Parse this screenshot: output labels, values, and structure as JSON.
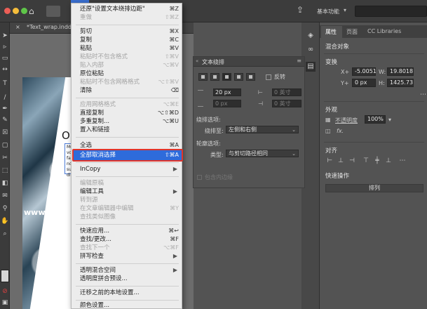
{
  "topbar": {
    "workspace": "基本功能",
    "workspace_chevron": "▾"
  },
  "document": {
    "tab_label": "*Text_wrap.indd @"
  },
  "canvas": {
    "heading_text": "O C",
    "body_lines": [
      "Mus vo",
      "volupt",
      "faces",
      "nonse",
      "sunt",
      "dia"
    ],
    "watermark": "www.MacZ"
  },
  "menu": {
    "items": [
      {
        "label": "还原\"设置文本绕排边距\"",
        "shortcut": "⌘Z",
        "disabled": false
      },
      {
        "label": "重做",
        "shortcut": "⇧⌘Z",
        "disabled": true
      },
      {
        "label": "剪切",
        "shortcut": "⌘X",
        "disabled": false
      },
      {
        "label": "复制",
        "shortcut": "⌘C",
        "disabled": false
      },
      {
        "label": "粘贴",
        "shortcut": "⌘V",
        "disabled": false
      },
      {
        "label": "粘贴时不包含格式",
        "shortcut": "⇧⌘V",
        "disabled": true
      },
      {
        "label": "贴入内部",
        "shortcut": "⌥⌘V",
        "disabled": true
      },
      {
        "label": "原位粘贴",
        "shortcut": "",
        "disabled": false
      },
      {
        "label": "粘贴时不包含网格格式",
        "shortcut": "⌥⇧⌘V",
        "disabled": true
      },
      {
        "label": "清除",
        "shortcut": "⌫",
        "disabled": false
      },
      {
        "label": "应用网格格式",
        "shortcut": "⌥⌘E",
        "disabled": true
      },
      {
        "label": "直接复制",
        "shortcut": "⌥⇧⌘D",
        "disabled": false
      },
      {
        "label": "多重复制...",
        "shortcut": "⌥⌘U",
        "disabled": false
      },
      {
        "label": "置入和链接",
        "shortcut": "",
        "disabled": false
      },
      {
        "label": "全选",
        "shortcut": "⌘A",
        "disabled": false
      },
      {
        "label": "全部取消选择",
        "shortcut": "⇧⌘A",
        "disabled": false,
        "selected": true
      },
      {
        "label": "InCopy",
        "shortcut": "",
        "disabled": false,
        "submenu": true
      },
      {
        "label": "编辑原稿",
        "shortcut": "",
        "disabled": true
      },
      {
        "label": "编辑工具",
        "shortcut": "",
        "disabled": false,
        "submenu": true
      },
      {
        "label": "转到源",
        "shortcut": "",
        "disabled": true
      },
      {
        "label": "在文章编辑器中编辑",
        "shortcut": "⌘Y",
        "disabled": true
      },
      {
        "label": "查找类似图像",
        "shortcut": "",
        "disabled": true
      },
      {
        "label": "快速应用...",
        "shortcut": "⌘↩",
        "disabled": false
      },
      {
        "label": "查找/更改...",
        "shortcut": "⌘F",
        "disabled": false
      },
      {
        "label": "查找下一个",
        "shortcut": "⌥⌘F",
        "disabled": true
      },
      {
        "label": "拼写检查",
        "shortcut": "",
        "disabled": false,
        "submenu": true
      },
      {
        "label": "透明混合空间",
        "shortcut": "",
        "disabled": false,
        "submenu": true
      },
      {
        "label": "透明度拼合预设...",
        "shortcut": "",
        "disabled": false
      },
      {
        "label": "迁移之前的本地设置...",
        "shortcut": "",
        "disabled": false
      },
      {
        "label": "颜色设置...",
        "shortcut": "",
        "disabled": false
      }
    ]
  },
  "wrap_panel": {
    "title": "文本绕排",
    "invert_label": "反转",
    "top_offset": "20 px",
    "bottom_offset": "0 px",
    "left_offset": "0 英寸",
    "right_offset": "0 英寸",
    "wrap_options_label": "绕排选项:",
    "wrap_to_label": "绕排至:",
    "wrap_to_value": "左侧和右侧",
    "contour_options_label": "轮廓选项:",
    "type_label": "类型:",
    "type_value": "与剪切路径相同",
    "include_edges_label": "包含内边缘"
  },
  "props": {
    "tabs": [
      "属性",
      "页面",
      "CC Libraries"
    ],
    "section_object": "混合对象",
    "section_transform": "变换",
    "x_label": "X+",
    "x_value": "-5.0051",
    "y_label": "Y+",
    "y_value": "0 px",
    "w_label": "W:",
    "w_value": "19.8018",
    "h_label": "H:",
    "h_value": "1425.73",
    "section_appearance": "外观",
    "opacity_label": "不透明度",
    "opacity_value": "100%",
    "fx_label": "fx.",
    "section_align": "对齐",
    "section_quick": "快速操作",
    "arrange_button": "排列"
  }
}
